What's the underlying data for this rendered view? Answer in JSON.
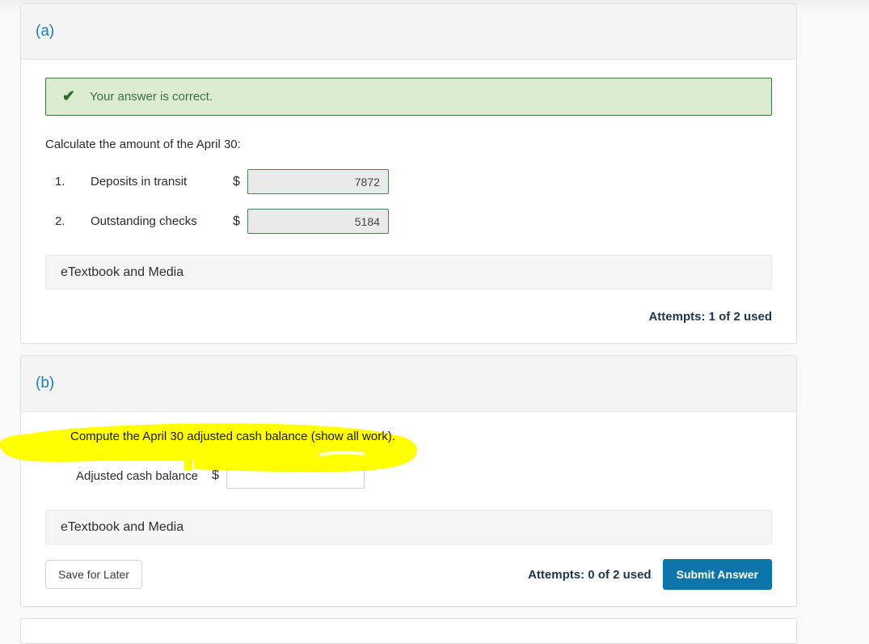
{
  "page": {
    "background_color": "#f9f9f9",
    "accent_blue": "#0d75aa",
    "label_blue": "#1c7eb5",
    "success_green_bg": "#dcecd0",
    "success_green_border": "#3c763d",
    "highlight_yellow": "#ffff00"
  },
  "part_a": {
    "label": "(a)",
    "alert": {
      "icon": "check-icon",
      "text": "Your answer is correct."
    },
    "instruction": "Calculate the amount of the April 30:",
    "rows": [
      {
        "number": "1.",
        "label": "Deposits in transit",
        "currency": "$",
        "value": "7872",
        "placeholder": ""
      },
      {
        "number": "2.",
        "label": "Outstanding checks",
        "currency": "$",
        "value": "5184",
        "placeholder": ""
      }
    ],
    "etextbook_label": "eTextbook and Media",
    "attempts": "Attempts: 1 of 2 used"
  },
  "part_b": {
    "label": "(b)",
    "question": "Compute the April 30 adjusted cash balance (show all work).",
    "balance_label": "Adjusted cash balance",
    "currency": "$",
    "balance_value": "",
    "balance_placeholder": "",
    "etextbook_label": "eTextbook and Media",
    "save_label": "Save for Later",
    "attempts": "Attempts: 0 of 2 used",
    "submit_label": "Submit Answer"
  }
}
